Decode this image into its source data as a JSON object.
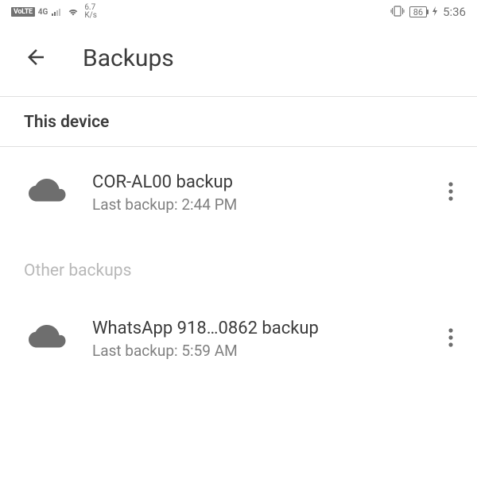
{
  "status_bar": {
    "volte_label": "VoLTE",
    "network_gen": "4G",
    "speed_value": "6.7",
    "speed_unit": "K/s",
    "battery_level": "86",
    "time": "5:36"
  },
  "header": {
    "title": "Backups"
  },
  "sections": {
    "this_device_label": "This device",
    "other_backups_label": "Other backups"
  },
  "backups": {
    "this_device": {
      "title": "COR-AL00 backup",
      "subtitle": "Last backup: 2:44 PM"
    },
    "other": {
      "title": "WhatsApp 918…0862 backup",
      "subtitle": "Last backup: 5:59 AM"
    }
  }
}
